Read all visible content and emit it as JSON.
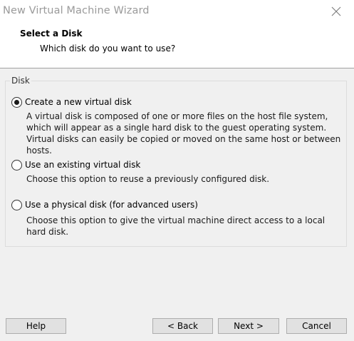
{
  "window": {
    "title": "New Virtual Machine Wizard"
  },
  "header": {
    "title": "Select a Disk",
    "subtitle": "Which disk do you want to use?"
  },
  "disk_group": {
    "label": "Disk",
    "options": [
      {
        "label": "Create a new virtual disk",
        "description": "A virtual disk is composed of one or more files on the host file system, which will appear as a single hard disk to the guest operating system. Virtual disks can easily be copied or moved on the same host or between hosts.",
        "selected": true
      },
      {
        "label": "Use an existing virtual disk",
        "description": "Choose this option to reuse a previously configured disk.",
        "selected": false
      },
      {
        "label": "Use a physical disk (for advanced users)",
        "description": "Choose this option to give the virtual machine direct access to a local hard disk.",
        "selected": false
      }
    ]
  },
  "buttons": {
    "help": "Help",
    "back": "< Back",
    "next": "Next >",
    "cancel": "Cancel"
  },
  "icons": {
    "close": "close-icon",
    "radio": "radio-button"
  }
}
